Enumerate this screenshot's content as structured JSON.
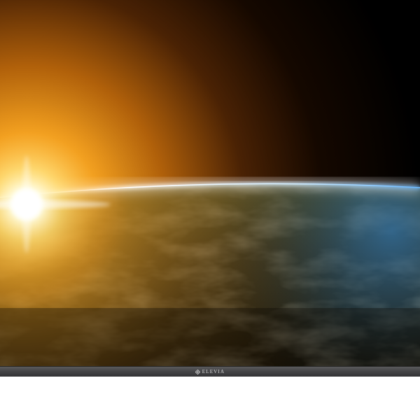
{
  "device": {
    "brand_name": "ELEVIA",
    "logo_icon": "diamond-logo-icon",
    "bezel_color": "#454547",
    "screen_scene": "sunrise-over-earth"
  },
  "colors": {
    "sun_core": "#fffbe6",
    "sun_glow": "#ffb020",
    "atmosphere": "#7ec8ff",
    "space": "#000000",
    "earth_land": "#6b5a2a",
    "earth_ocean": "#1e3a5a"
  }
}
